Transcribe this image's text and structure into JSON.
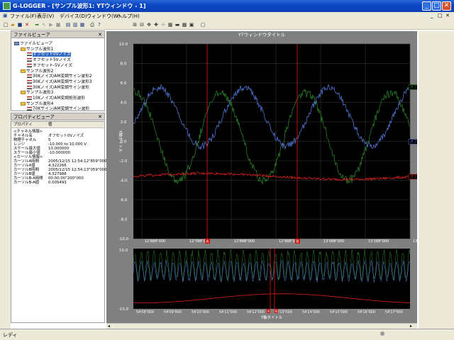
{
  "window": {
    "title": "G-LOGGER - [サンプル波形1: YTウィンドウ - 1]",
    "min": "_",
    "max": "□",
    "close": "✕"
  },
  "menu": [
    "ファイル(F)",
    "表示(V)",
    "デバイス(D)",
    "ウィンドウ(W)",
    "ヘルプ(H)"
  ],
  "menu_controls": [
    "_",
    "□",
    "✕"
  ],
  "toolbar_icons": [
    "new-icon",
    "open-icon",
    "save-icon",
    "delete-icon",
    "record-icon",
    "cursor-icon",
    "play-icon",
    "stop-icon",
    "layout-icon",
    "layout2-icon",
    "layout3-icon",
    "print-icon",
    "help-icon",
    "zoom-icon",
    "fit-icon",
    "move-icon",
    "cross-icon",
    "measure-icon",
    "table-icon",
    "bar-icon",
    "grid-icon",
    "window-icon"
  ],
  "file_viewer": {
    "title": "ファイルビューア",
    "nodes": [
      {
        "label": "ファイルビューア",
        "level": 0,
        "icon": "pc"
      },
      {
        "label": "サンプル波形1",
        "level": 1,
        "icon": "folder"
      },
      {
        "label": "オフセット0Vノイズ",
        "level": 2,
        "icon": "sig",
        "selected": true
      },
      {
        "label": "オフセット5Vノイズ",
        "level": 2,
        "icon": "sig"
      },
      {
        "label": "オフセット-5Vノイズ",
        "level": 2,
        "icon": "sig"
      },
      {
        "label": "サンプル波形2",
        "level": 1,
        "icon": "folder"
      },
      {
        "label": "30Kノイズ/AM変調サイン波形2",
        "level": 2,
        "icon": "sig"
      },
      {
        "label": "30Kノイズ/AM変調サイン波形3",
        "level": 2,
        "icon": "sig"
      },
      {
        "label": "30Kノイズ/AM変調サイン波形",
        "level": 2,
        "icon": "sig"
      },
      {
        "label": "サンプル波形3",
        "level": 1,
        "icon": "folder"
      },
      {
        "label": "10Kノイズ/AM変調矩形波形",
        "level": 2,
        "icon": "sig"
      },
      {
        "label": "サンプル波形4",
        "level": 1,
        "icon": "folder"
      },
      {
        "label": "70Kサイン/AM変調サイン波形",
        "level": 2,
        "icon": "sig"
      }
    ]
  },
  "property_viewer": {
    "title": "プロパティビューア",
    "col_prop": "プロパティ",
    "col_val": "値",
    "rows": [
      {
        "k": "<チャネル情報>",
        "v": ""
      },
      {
        "k": "チャネル名",
        "v": "オフセット0Vノイズ"
      },
      {
        "k": "物理チャネル",
        "v": "5"
      },
      {
        "k": "レンジ",
        "v": "-10.000 to 10.000 V"
      },
      {
        "k": "スケール最大値",
        "v": "10.000000"
      },
      {
        "k": "スケール最小値",
        "v": "-10.000000"
      },
      {
        "k": "<カーソル情報>",
        "v": ""
      },
      {
        "k": "カーソルA時間",
        "v": "2005/12/15 12:54:12\"859\"000"
      },
      {
        "k": "カーソルA値",
        "v": "4.322266"
      },
      {
        "k": "カーソルB時間",
        "v": "2005/12/15 12:54:13\"059\"000"
      },
      {
        "k": "カーソルB値",
        "v": "4.327988"
      },
      {
        "k": "カーソルB-A時間",
        "v": "00:00:00\"200\"000"
      },
      {
        "k": "カーソルB-A値",
        "v": "0.005493"
      }
    ]
  },
  "main_chart": {
    "title": "YTウィンドウタイトル",
    "ylabel": "Y軸タイトル",
    "cursor_a": "A",
    "cursor_b": "B",
    "legend": [
      "オフセット5",
      "オフセット0",
      "オフセット-5"
    ]
  },
  "overview_chart": {
    "xlabel": "T軸タイトル",
    "cursor_a": "A",
    "cursor_b": "B"
  },
  "status": {
    "text": "レディ"
  },
  "colors": {
    "blue": "#5a7fe8",
    "green": "#2a8a2a",
    "red": "#e02020",
    "cursor": "#d01818",
    "bg": "#000000"
  },
  "chart_data": [
    {
      "type": "line",
      "title": "YTウィンドウタイトル",
      "ylabel": "Y軸タイトル",
      "ylim": [
        -10,
        10
      ],
      "yticks": [
        "10.0",
        "8.0",
        "6.0",
        "4.0",
        "2.0",
        "0.0",
        "-2.0",
        "-4.0",
        "-6.0",
        "-8.0",
        "-10.0"
      ],
      "xticks": [
        "12'688\"000",
        "12'788\"000",
        "12'888\"000",
        "12'988\"000",
        "13'088\"000",
        "13'188\"000",
        "13'28"
      ],
      "cursors": {
        "A": 12.859,
        "B": 13.059
      },
      "series": [
        {
          "name": "オフセット5",
          "color": "#2a8a2a",
          "offset": 0.5,
          "amp": 4.5
        },
        {
          "name": "オフセット0",
          "color": "#5a7fe8",
          "offset": 2.5,
          "amp": 3.0
        },
        {
          "name": "オフセット-5",
          "color": "#e02020",
          "offset": -3.6,
          "amp": 0.3
        }
      ]
    },
    {
      "type": "line",
      "xlabel": "T軸タイトル",
      "ylim": [
        -10,
        10
      ],
      "yticks": [
        "10.0",
        "-10.0"
      ],
      "xticks": [
        "54'08\"000",
        "54'09\"000",
        "54'10\"000",
        "54'11\"000",
        "54'12\"000",
        "54'13\"000",
        "54'14\"000",
        "54'15\"000",
        "54'16\"000",
        "54'17\"000"
      ]
    }
  ]
}
